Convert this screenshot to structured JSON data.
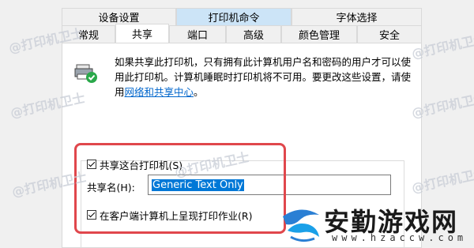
{
  "tabs_row1": [
    "设备设置",
    "打印机命令",
    "字体选择"
  ],
  "tabs_row2": [
    "常规",
    "共享",
    "端口",
    "高级",
    "颜色管理",
    "安全"
  ],
  "description": {
    "text": "如果共享此打印机，只有拥有此计算机用户名和密码的用户才可以使用此打印机。计算机睡眠时打印机将不可用。要更改这些设置，请使用",
    "link": "网络和共享中心",
    "suffix": "。"
  },
  "share": {
    "share_checkbox_label": "共享这台打印机(S)",
    "share_name_label": "共享名(H):",
    "share_name_value": "Generic  Text Only",
    "render_checkbox_label": "在客户端计算机上呈现打印作业(R)"
  },
  "watermark_text": "@打印机卫士",
  "brand": {
    "name": "安勤游戏网",
    "url": "www.hzaccw.com"
  },
  "colors": {
    "annotation": "#e0474c",
    "link": "#0066cc",
    "selection": "#0078d7"
  }
}
